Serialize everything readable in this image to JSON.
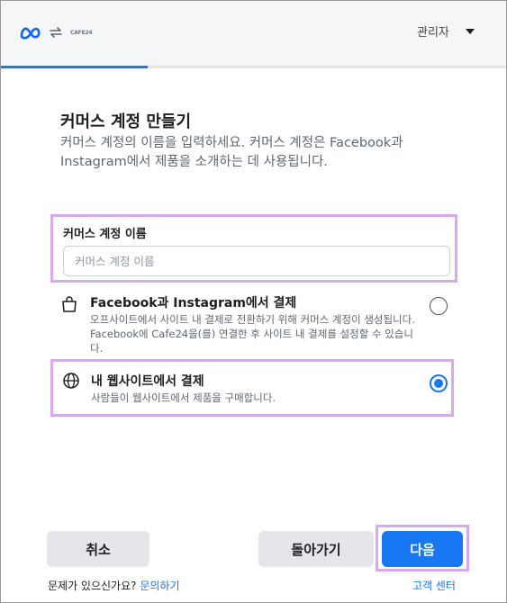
{
  "header": {
    "brand_icon": "meta-logo-icon",
    "sync_icon": "sync-arrows-icon",
    "partner_logo": "CAFE24",
    "admin_label": "관리자",
    "progress": 0.29
  },
  "main": {
    "title": "커머스 계정 만들기",
    "description": "커머스 계정의 이름을 입력하세요. 커머스 계정은 Facebook과 Instagram에서 제품을 소개하는 데 사용됩니다.",
    "name_field": {
      "label": "커머스 계정 이름",
      "placeholder": "커머스 계정 이름",
      "value": ""
    },
    "options": [
      {
        "icon": "shopping-bag-icon",
        "title": "Facebook과 Instagram에서 결제",
        "description": "오프사이트에서 사이트 내 결제로 전환하기 위해 커머스 계정이 생성됩니다. Facebook에 Cafe24을(를) 연결한 후 사이트 내 결제를 설정할 수 있습니다.",
        "selected": false
      },
      {
        "icon": "globe-icon",
        "title": "내 웹사이트에서 결제",
        "description": "사람들이 웹사이트에서 제품을 구매합니다.",
        "selected": true
      }
    ]
  },
  "footer": {
    "cancel_label": "취소",
    "back_label": "돌아가기",
    "next_label": "다음",
    "question_text": "문제가 있으신가요?",
    "contact_link": "문의하기",
    "help_center": "고객 센터"
  },
  "colors": {
    "accent": "#1877f2",
    "highlight": "#d8a8f0",
    "secondary_button": "#e4e6eb"
  }
}
